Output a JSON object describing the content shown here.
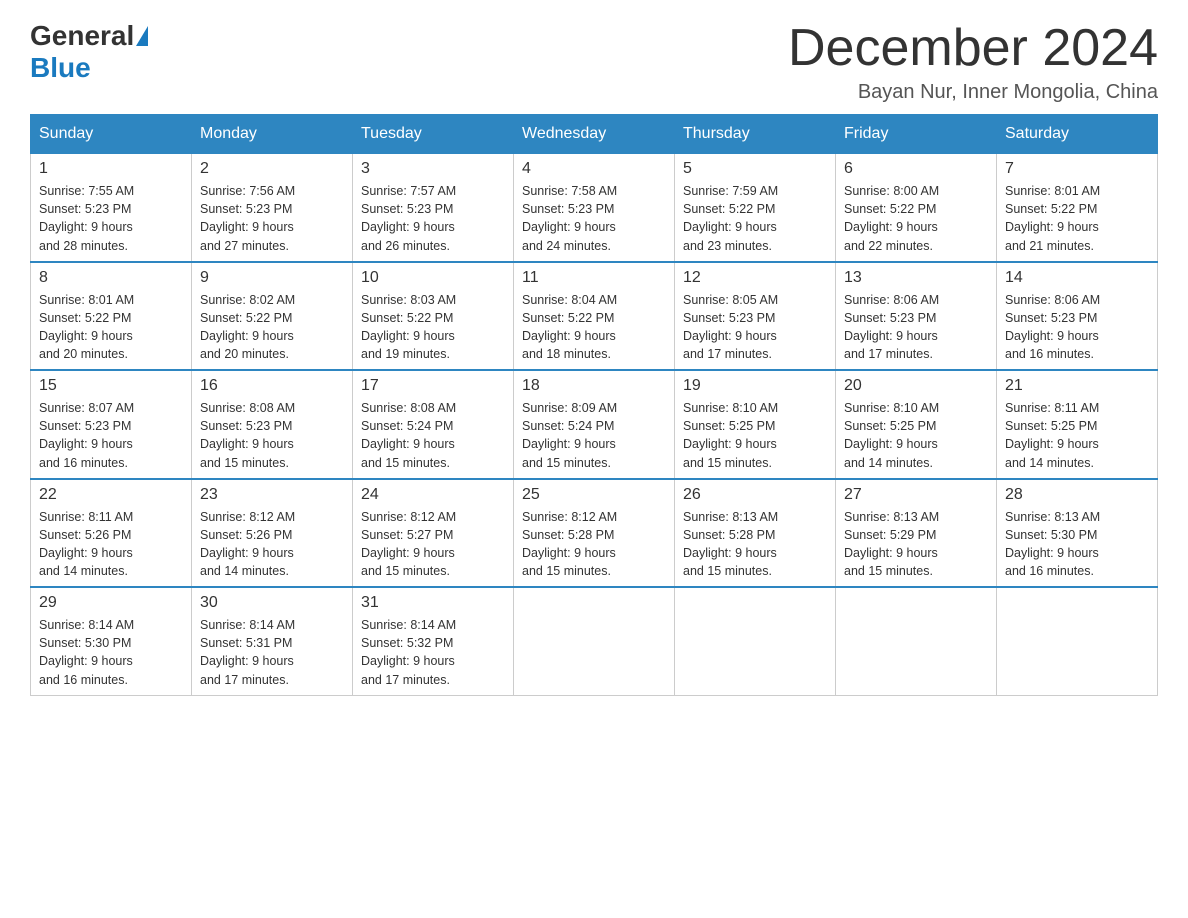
{
  "header": {
    "logo_general": "General",
    "logo_blue": "Blue",
    "month_title": "December 2024",
    "location": "Bayan Nur, Inner Mongolia, China"
  },
  "days_of_week": [
    "Sunday",
    "Monday",
    "Tuesday",
    "Wednesday",
    "Thursday",
    "Friday",
    "Saturday"
  ],
  "weeks": [
    [
      {
        "num": "1",
        "sunrise": "7:55 AM",
        "sunset": "5:23 PM",
        "daylight": "9 hours and 28 minutes."
      },
      {
        "num": "2",
        "sunrise": "7:56 AM",
        "sunset": "5:23 PM",
        "daylight": "9 hours and 27 minutes."
      },
      {
        "num": "3",
        "sunrise": "7:57 AM",
        "sunset": "5:23 PM",
        "daylight": "9 hours and 26 minutes."
      },
      {
        "num": "4",
        "sunrise": "7:58 AM",
        "sunset": "5:23 PM",
        "daylight": "9 hours and 24 minutes."
      },
      {
        "num": "5",
        "sunrise": "7:59 AM",
        "sunset": "5:22 PM",
        "daylight": "9 hours and 23 minutes."
      },
      {
        "num": "6",
        "sunrise": "8:00 AM",
        "sunset": "5:22 PM",
        "daylight": "9 hours and 22 minutes."
      },
      {
        "num": "7",
        "sunrise": "8:01 AM",
        "sunset": "5:22 PM",
        "daylight": "9 hours and 21 minutes."
      }
    ],
    [
      {
        "num": "8",
        "sunrise": "8:01 AM",
        "sunset": "5:22 PM",
        "daylight": "9 hours and 20 minutes."
      },
      {
        "num": "9",
        "sunrise": "8:02 AM",
        "sunset": "5:22 PM",
        "daylight": "9 hours and 20 minutes."
      },
      {
        "num": "10",
        "sunrise": "8:03 AM",
        "sunset": "5:22 PM",
        "daylight": "9 hours and 19 minutes."
      },
      {
        "num": "11",
        "sunrise": "8:04 AM",
        "sunset": "5:22 PM",
        "daylight": "9 hours and 18 minutes."
      },
      {
        "num": "12",
        "sunrise": "8:05 AM",
        "sunset": "5:23 PM",
        "daylight": "9 hours and 17 minutes."
      },
      {
        "num": "13",
        "sunrise": "8:06 AM",
        "sunset": "5:23 PM",
        "daylight": "9 hours and 17 minutes."
      },
      {
        "num": "14",
        "sunrise": "8:06 AM",
        "sunset": "5:23 PM",
        "daylight": "9 hours and 16 minutes."
      }
    ],
    [
      {
        "num": "15",
        "sunrise": "8:07 AM",
        "sunset": "5:23 PM",
        "daylight": "9 hours and 16 minutes."
      },
      {
        "num": "16",
        "sunrise": "8:08 AM",
        "sunset": "5:23 PM",
        "daylight": "9 hours and 15 minutes."
      },
      {
        "num": "17",
        "sunrise": "8:08 AM",
        "sunset": "5:24 PM",
        "daylight": "9 hours and 15 minutes."
      },
      {
        "num": "18",
        "sunrise": "8:09 AM",
        "sunset": "5:24 PM",
        "daylight": "9 hours and 15 minutes."
      },
      {
        "num": "19",
        "sunrise": "8:10 AM",
        "sunset": "5:25 PM",
        "daylight": "9 hours and 15 minutes."
      },
      {
        "num": "20",
        "sunrise": "8:10 AM",
        "sunset": "5:25 PM",
        "daylight": "9 hours and 14 minutes."
      },
      {
        "num": "21",
        "sunrise": "8:11 AM",
        "sunset": "5:25 PM",
        "daylight": "9 hours and 14 minutes."
      }
    ],
    [
      {
        "num": "22",
        "sunrise": "8:11 AM",
        "sunset": "5:26 PM",
        "daylight": "9 hours and 14 minutes."
      },
      {
        "num": "23",
        "sunrise": "8:12 AM",
        "sunset": "5:26 PM",
        "daylight": "9 hours and 14 minutes."
      },
      {
        "num": "24",
        "sunrise": "8:12 AM",
        "sunset": "5:27 PM",
        "daylight": "9 hours and 15 minutes."
      },
      {
        "num": "25",
        "sunrise": "8:12 AM",
        "sunset": "5:28 PM",
        "daylight": "9 hours and 15 minutes."
      },
      {
        "num": "26",
        "sunrise": "8:13 AM",
        "sunset": "5:28 PM",
        "daylight": "9 hours and 15 minutes."
      },
      {
        "num": "27",
        "sunrise": "8:13 AM",
        "sunset": "5:29 PM",
        "daylight": "9 hours and 15 minutes."
      },
      {
        "num": "28",
        "sunrise": "8:13 AM",
        "sunset": "5:30 PM",
        "daylight": "9 hours and 16 minutes."
      }
    ],
    [
      {
        "num": "29",
        "sunrise": "8:14 AM",
        "sunset": "5:30 PM",
        "daylight": "9 hours and 16 minutes."
      },
      {
        "num": "30",
        "sunrise": "8:14 AM",
        "sunset": "5:31 PM",
        "daylight": "9 hours and 17 minutes."
      },
      {
        "num": "31",
        "sunrise": "8:14 AM",
        "sunset": "5:32 PM",
        "daylight": "9 hours and 17 minutes."
      },
      null,
      null,
      null,
      null
    ]
  ]
}
